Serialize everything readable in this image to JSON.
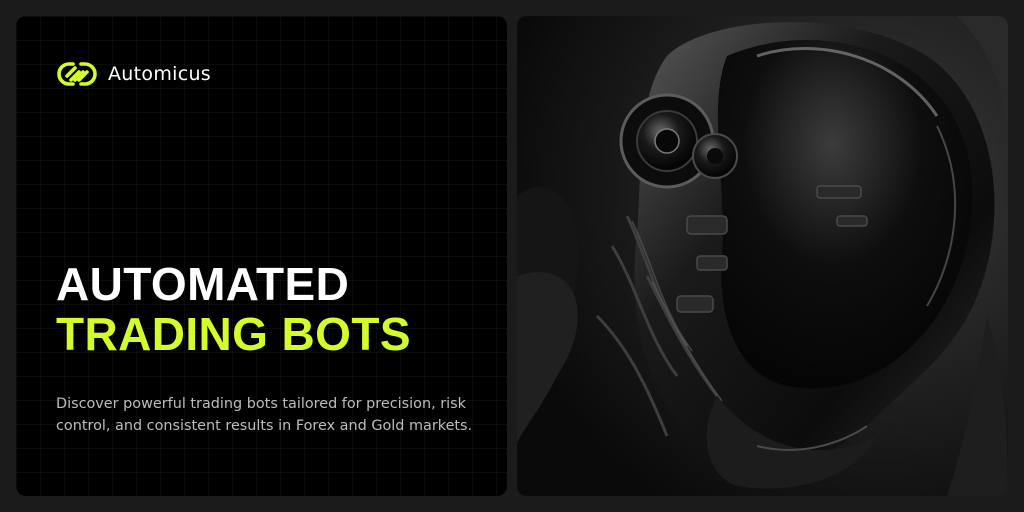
{
  "brand": {
    "name": "Automicus",
    "accent_color": "#d4fb2b",
    "logo_icon": "interlocking-rings-icon"
  },
  "hero": {
    "title_line_1": "AUTOMATED",
    "title_line_2": "TRADING BOTS",
    "description": "Discover powerful trading bots tailored for precision, risk control, and consistent results in Forex and Gold markets."
  },
  "image": {
    "subject": "robot-head-icon"
  }
}
